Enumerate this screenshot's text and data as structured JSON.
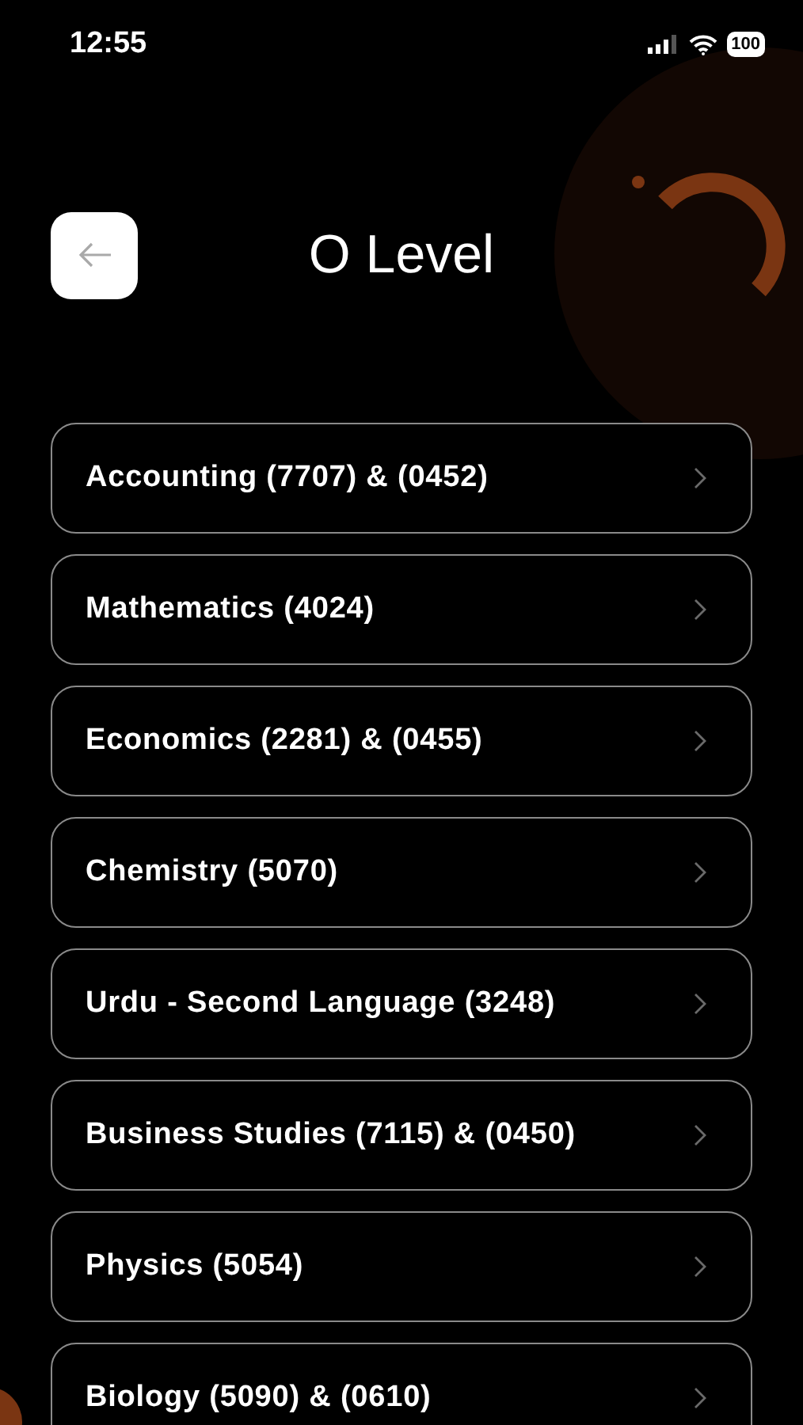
{
  "status_bar": {
    "time": "12:55",
    "battery": "100"
  },
  "header": {
    "title": "O Level"
  },
  "subjects": [
    {
      "label": "Accounting (7707) & (0452)"
    },
    {
      "label": "Mathematics (4024)"
    },
    {
      "label": "Economics (2281) & (0455)"
    },
    {
      "label": "Chemistry (5070)"
    },
    {
      "label": "Urdu - Second Language (3248)"
    },
    {
      "label": "Business Studies (7115) & (0450)"
    },
    {
      "label": "Physics (5054)"
    },
    {
      "label": "Biology (5090) & (0610)"
    }
  ]
}
